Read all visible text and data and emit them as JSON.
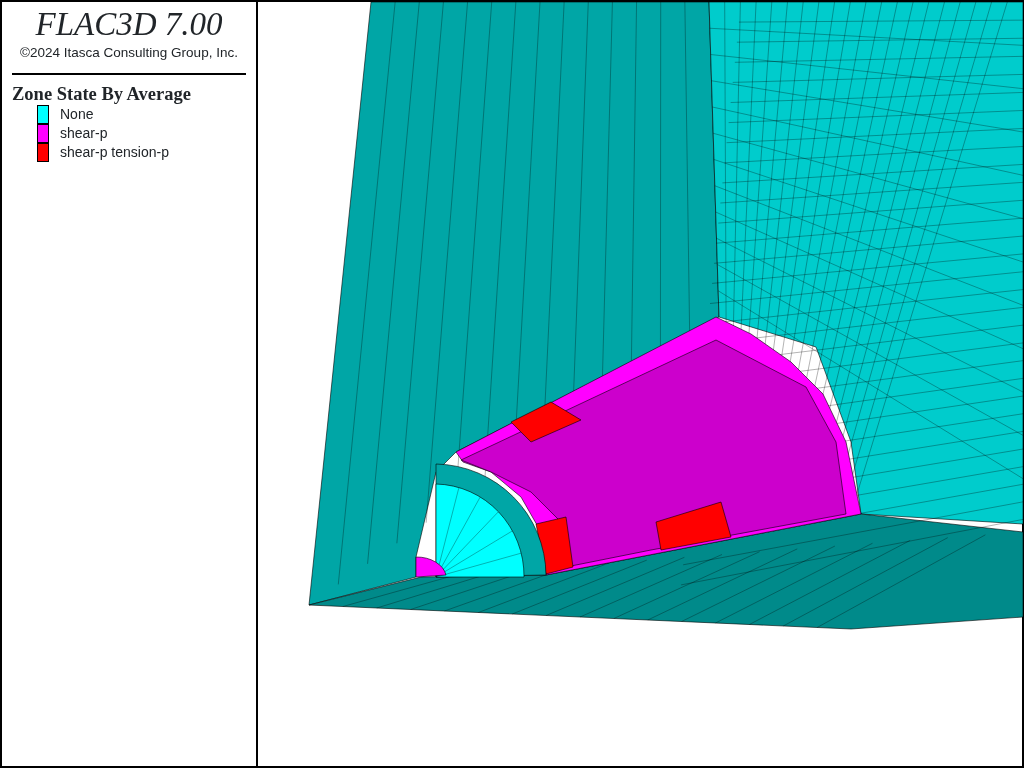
{
  "legend_panel": {
    "title": "FLAC3D 7.00",
    "copyright": "©2024 Itasca Consulting Group, Inc.",
    "legend_title": "Zone State By Average",
    "items": [
      {
        "label": "None",
        "color": "#00ffff"
      },
      {
        "label": "shear-p",
        "color": "#ff00ff"
      },
      {
        "label": "shear-p tension-p",
        "color": "#ff0000"
      }
    ]
  }
}
